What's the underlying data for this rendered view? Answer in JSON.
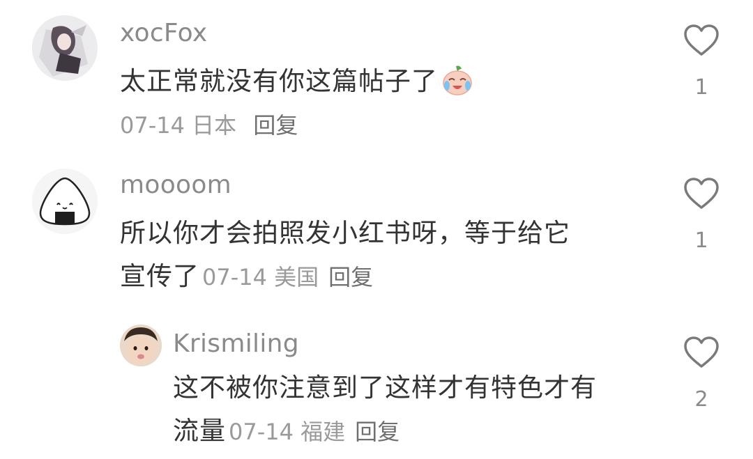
{
  "comments": [
    {
      "username": "xocFox",
      "text": "太正常就没有你这篇帖子了",
      "emoji": "crying-laughing-emoji",
      "date": "07-14",
      "location": "日本",
      "reply_label": "回复",
      "likes": "1"
    },
    {
      "username": "moooom",
      "text_line1": "所以你才会拍照发小红书呀，等于给它",
      "text_line2": "宣传了",
      "date": "07-14",
      "location": "美国",
      "reply_label": "回复",
      "likes": "1"
    },
    {
      "username": "Krismiling",
      "text_line1": "这不被你注意到了这样才有特色才有",
      "text_line2": "流量",
      "date": "07-14",
      "location": "福建",
      "reply_label": "回复",
      "likes": "2"
    }
  ],
  "colors": {
    "username": "#8a8a8a",
    "text": "#333333",
    "meta": "#9a9a9a",
    "heart_outline": "#7a7a7a"
  }
}
